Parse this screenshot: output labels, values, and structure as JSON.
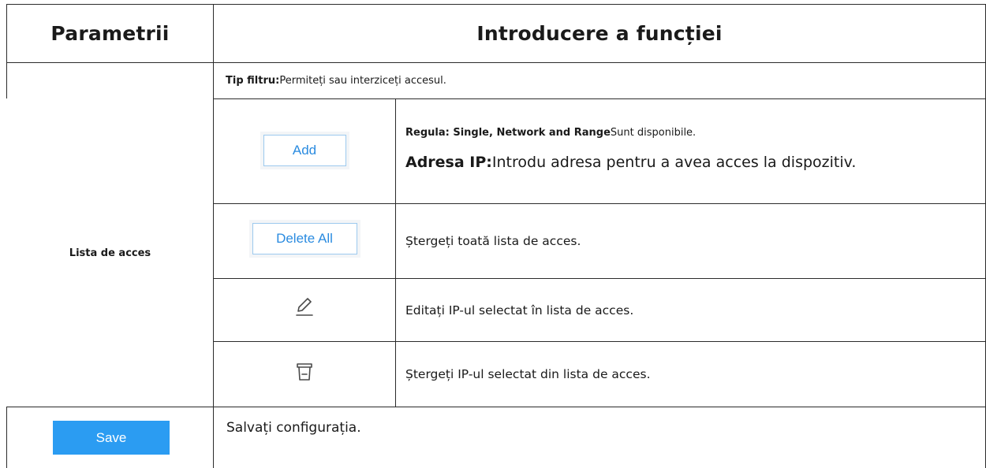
{
  "header": {
    "col1": "Parametrii",
    "col2": "Introducere a funcției"
  },
  "access_list": {
    "label": "Lista de acces",
    "filter_type_label": "Tip filtru:",
    "filter_type_desc": "Permiteți sau interziceți accesul.",
    "add_button": "Add",
    "rule_label": "Regula: Single, Network and Range",
    "rule_desc": "Sunt disponibile.",
    "ip_label": "Adresa IP:",
    "ip_desc": "Introdu adresa pentru a avea acces la dispozitiv.",
    "delete_all_button": "Delete All",
    "delete_all_desc": "Ștergeți toată lista de acces.",
    "edit_icon": "pencil-icon",
    "edit_desc": "Editați IP-ul selectat în lista de acces.",
    "delete_icon": "trash-icon",
    "delete_desc": "Ștergeți IP-ul selectat din lista de acces."
  },
  "save": {
    "button": "Save",
    "desc": "Salvați configurația."
  },
  "colors": {
    "accent_blue": "#2b9cf2",
    "outline_blue": "#2a8be0",
    "border": "#2b2b2b"
  }
}
